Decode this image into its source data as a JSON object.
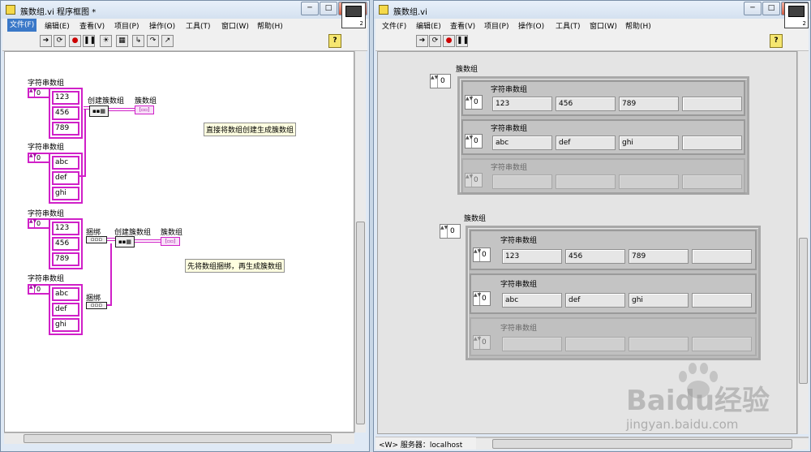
{
  "block_diagram": {
    "title": "簇数组.vi 程序框图 *",
    "menu": [
      "文件(F)",
      "编辑(E)",
      "查看(V)",
      "项目(P)",
      "操作(O)",
      "工具(T)",
      "窗口(W)",
      "帮助(H)"
    ],
    "icon_number": "2",
    "label_string_array": "字符串数组",
    "label_build_cluster_array": "创建簇数组",
    "label_cluster_array": "簇数组",
    "label_bundle": "捆绑",
    "index_value": "0",
    "array1": [
      "123",
      "456",
      "789"
    ],
    "array2": [
      "abc",
      "def",
      "ghi"
    ],
    "note1": "直接将数组创建生成簇数组",
    "note2": "先将数组捆绑，再生成簇数组"
  },
  "front_panel": {
    "title": "簇数组.vi",
    "menu": [
      "文件(F)",
      "编辑(E)",
      "查看(V)",
      "项目(P)",
      "操作(O)",
      "工具(T)",
      "窗口(W)",
      "帮助(H)"
    ],
    "icon_number": "2",
    "label_cluster_array": "簇数组",
    "label_string_array": "字符串数组",
    "index_value": "0",
    "row1": [
      "123",
      "456",
      "789",
      ""
    ],
    "row2": [
      "abc",
      "def",
      "ghi",
      ""
    ],
    "row3": [
      "",
      "",
      "",
      ""
    ],
    "status_server": "<W> 服务器：localhost"
  },
  "watermark": {
    "brand": "Baidu经验",
    "url": "jingyan.baidu.com"
  },
  "window_controls": {
    "min": "─",
    "max": "□",
    "close": "X"
  }
}
